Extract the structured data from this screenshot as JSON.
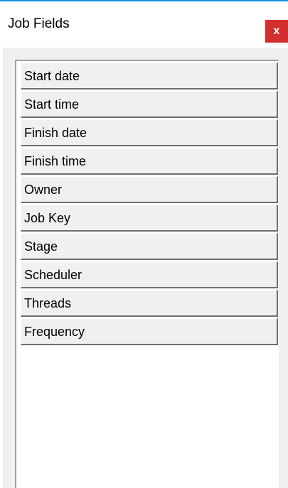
{
  "window": {
    "title": "Job Fields",
    "close_label": "x"
  },
  "fields": [
    {
      "label": "Start date"
    },
    {
      "label": "Start time"
    },
    {
      "label": "Finish date"
    },
    {
      "label": "Finish time"
    },
    {
      "label": "Owner"
    },
    {
      "label": "Job Key"
    },
    {
      "label": "Stage"
    },
    {
      "label": "Scheduler"
    },
    {
      "label": "Threads"
    },
    {
      "label": "Frequency"
    }
  ],
  "colors": {
    "accent": "#1e90e0",
    "close_button": "#d32f2f",
    "panel_background": "#f0f0f0"
  }
}
